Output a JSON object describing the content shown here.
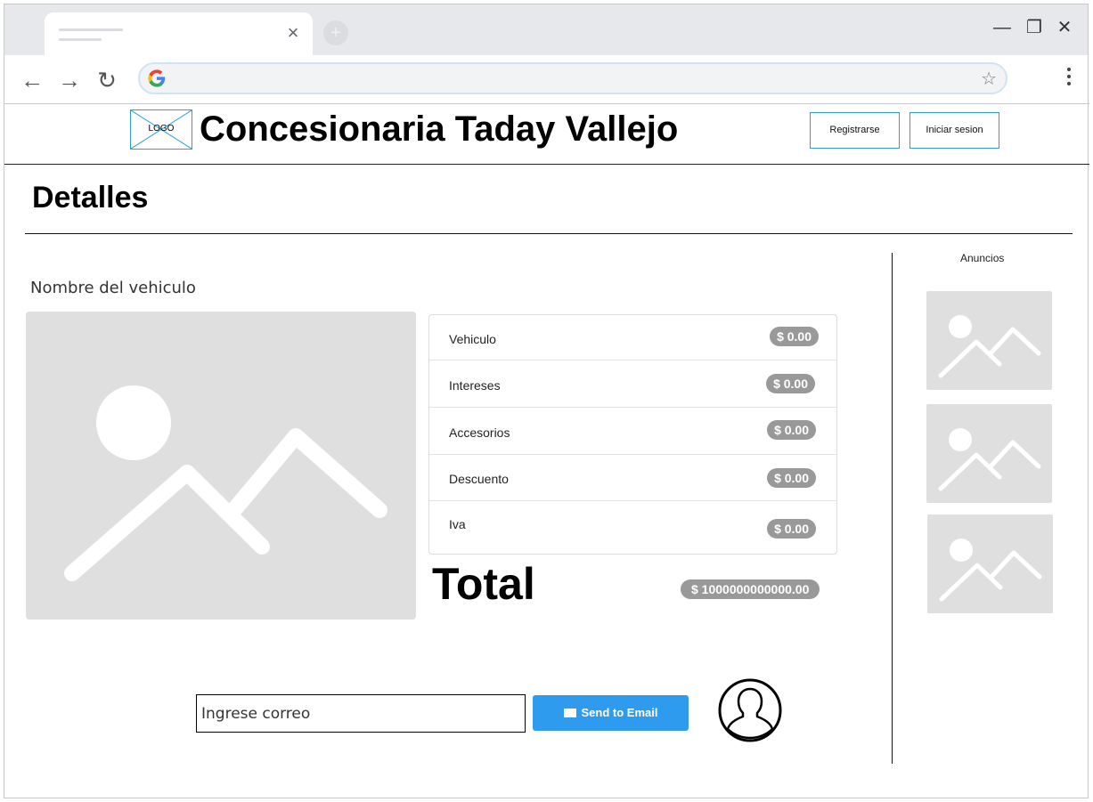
{
  "browser": {
    "tab_close": "×",
    "new_tab": "+",
    "window": {
      "minimize": "—",
      "maximize": "❐",
      "close": "✕"
    },
    "nav": {
      "back": "←",
      "forward": "→",
      "reload": "↻"
    },
    "address_value": "",
    "star": "☆"
  },
  "header": {
    "logo_text": "LOGO",
    "title": "Concesionaria Taday Vallejo",
    "register_label": "Registrarse",
    "login_label": "Iniciar sesion",
    "accent": "#2aa0d5"
  },
  "main": {
    "heading": "Detalles",
    "vehicle_name": "Nombre del vehiculo",
    "costs": [
      {
        "label": "Vehiculo",
        "amount": "$ 0.00"
      },
      {
        "label": "Intereses",
        "amount": "$ 0.00"
      },
      {
        "label": "Accesorios",
        "amount": "$ 0.00"
      },
      {
        "label": "Descuento",
        "amount": "$ 0.00"
      },
      {
        "label": "Iva",
        "amount": "$ 0.00"
      }
    ],
    "total_label": "Total",
    "total_amount": "$ 1000000000000.00",
    "email_placeholder": "Ingrese correo",
    "send_label": "Send to Email",
    "send_color": "#2f9bef"
  },
  "sidebar": {
    "title": "Anuncios",
    "ads_count_icons": [
      "image-placeholder-icon",
      "image-placeholder-icon",
      "image-placeholder-icon"
    ]
  }
}
